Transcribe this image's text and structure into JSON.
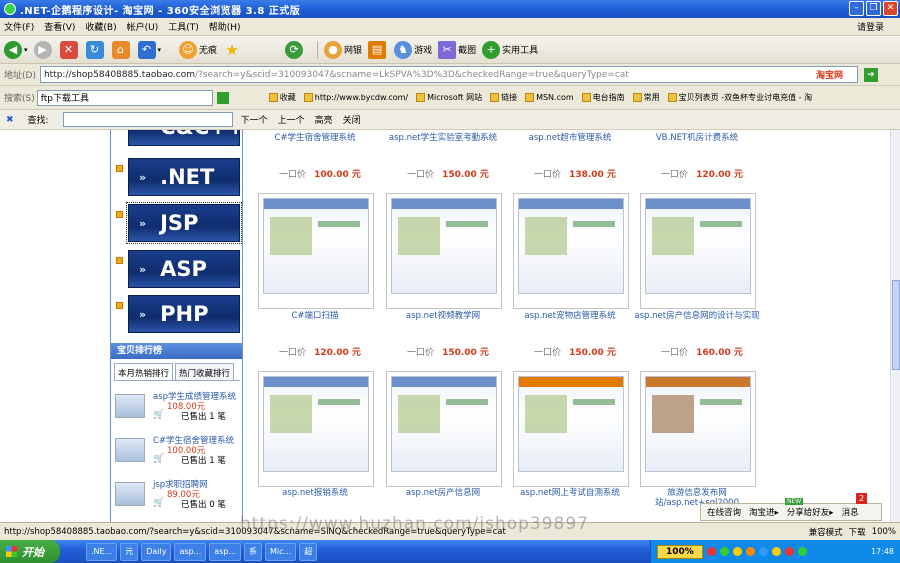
{
  "window": {
    "title": ".NET-企鹅程序设计- 淘宝网 - 360安全浏览器 3.8 正式版"
  },
  "menu": {
    "items": [
      "文件(F)",
      "查看(V)",
      "收藏(B)",
      "帐户(U)",
      "工具(T)",
      "帮助(H)"
    ],
    "login": "请登录"
  },
  "toolbar": {
    "noimg": "无痕",
    "screenshot": "网银",
    "games": "游戏",
    "capture": "截图",
    "tools": "实用工具"
  },
  "address": {
    "label": "地址(D)",
    "host": "http://shop58408885.taobao.com",
    "rest": "/?search=y&scid=310093047&scname=LkSPVA%3D%3D&checkedRange=true&queryType=cat",
    "brand": "淘宝网"
  },
  "favbar": {
    "label": "搜索(S)",
    "search_value": "ftp下载工具",
    "collect": "收藏",
    "items": [
      "http://www.bycdw.com/",
      "Microsoft 网站",
      "链接",
      "MSN.com",
      "电台指南",
      "常用",
      "宝贝列表页 -双鱼杯专业讨电充值 - 淘"
    ]
  },
  "find": {
    "label": "查找:",
    "next": "下一个",
    "prev": "上一个",
    "highlight": "高亮",
    "close": "关闭"
  },
  "categories": [
    {
      "name": "C&C++"
    },
    {
      "name": ".NET"
    },
    {
      "name": "JSP"
    },
    {
      "name": "ASP"
    },
    {
      "name": "PHP"
    }
  ],
  "rank": {
    "title": "宝贝排行榜",
    "tabs": [
      "本月热销排行",
      "热门收藏排行"
    ]
  },
  "ranked": [
    {
      "name": "asp学生成绩管理系统",
      "price": "108.00元",
      "sold": "已售出 1 笔"
    },
    {
      "name": "C#学生宿舍管理系统",
      "price": "100.00元",
      "sold": "已售出 1 笔"
    },
    {
      "name": "jsp求职招聘网",
      "price": "89.00元",
      "sold": "已售出 0 笔"
    }
  ],
  "row0": [
    {
      "name": "C#学生宿舍管理系统",
      "price_label": "一口价",
      "price": "100.00 元"
    },
    {
      "name": "asp.net学生实验室考勤系统",
      "price_label": "一口价",
      "price": "150.00 元"
    },
    {
      "name": "asp.net超市管理系统",
      "price_label": "一口价",
      "price": "138.00 元"
    },
    {
      "name": "VB.NET机房计费系统",
      "price_label": "一口价",
      "price": "120.00 元"
    }
  ],
  "row1": [
    {
      "name": "C#端口扫描",
      "price_label": "一口价",
      "price": "120.00 元"
    },
    {
      "name": "asp.net视频教学网",
      "price_label": "一口价",
      "price": "150.00 元"
    },
    {
      "name": "asp.net宠物店管理系统",
      "price_label": "一口价",
      "price": "150.00 元"
    },
    {
      "name": "asp.net房产信息网的设计与实现",
      "price_label": "一口价",
      "price": "160.00 元"
    }
  ],
  "row2": [
    {
      "name": "asp.net报销系统"
    },
    {
      "name": "asp.net房产信息网"
    },
    {
      "name": "asp.net网上考试自测系统"
    },
    {
      "name": "旅游信息发布网站/asp.net+sql2000"
    }
  ],
  "status": {
    "url": "http://shop58408885.taobao.com/?search=y&scid=310093047&scname=SlNQ&checkedRange=true&queryType=cat",
    "mode": "兼容模式",
    "download": "下载",
    "zoom": "100%"
  },
  "chat": {
    "online": "在线咨询",
    "go": "淘宝进▸",
    "share": "分享给好友▸",
    "msg": "消息",
    "badge": "2"
  },
  "watermark": "https://www.huzhan.com/ishop39897",
  "taskbar": {
    "start": "开始",
    "tasks": [
      ".NE...",
      "元",
      "Daily",
      "asp...",
      "asp...",
      "系",
      "Mic...",
      "超"
    ],
    "zoom": "100%",
    "time": "17:48"
  }
}
